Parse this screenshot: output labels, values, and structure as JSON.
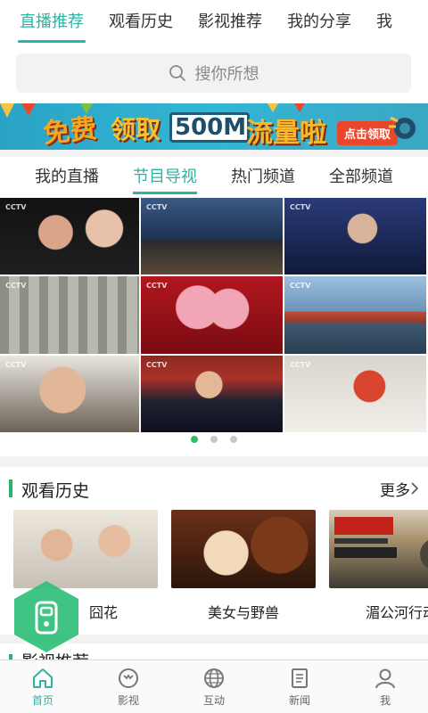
{
  "top_tabs": [
    {
      "label": "直播推荐",
      "active": true
    },
    {
      "label": "观看历史",
      "active": false
    },
    {
      "label": "影视推荐",
      "active": false
    },
    {
      "label": "我的分享",
      "active": false
    },
    {
      "label": "我",
      "active": false
    }
  ],
  "search": {
    "placeholder": "搜你所想"
  },
  "banner": {
    "text_free": "免费",
    "text_get": "领取",
    "text_amount": "500M",
    "text_flow": "流量啦",
    "cta": "点击领取"
  },
  "channel_tabs": [
    {
      "label": "我的直播",
      "active": false
    },
    {
      "label": "节目导视",
      "active": true
    },
    {
      "label": "热门频道",
      "active": false
    },
    {
      "label": "全部频道",
      "active": false
    }
  ],
  "video_grid": {
    "channel_logo": "CCTV",
    "items": [
      {
        "name": "video-1"
      },
      {
        "name": "video-2"
      },
      {
        "name": "video-3"
      },
      {
        "name": "video-4"
      },
      {
        "name": "video-5"
      },
      {
        "name": "video-6"
      },
      {
        "name": "video-7"
      },
      {
        "name": "video-8"
      },
      {
        "name": "video-9"
      }
    ],
    "page_indicator": {
      "count": 3,
      "active_index": 0
    }
  },
  "history": {
    "title": "观看历史",
    "more": "更多",
    "items": [
      {
        "title": "囧花"
      },
      {
        "title": "美女与野兽"
      },
      {
        "title": "湄公河行动"
      }
    ]
  },
  "next_section": {
    "title": "影视推荐"
  },
  "bottom_nav": [
    {
      "label": "首页",
      "icon": "home-icon",
      "active": true
    },
    {
      "label": "影视",
      "icon": "film-icon",
      "active": false
    },
    {
      "label": "互动",
      "icon": "globe-icon",
      "active": false
    },
    {
      "label": "新闻",
      "icon": "news-icon",
      "active": false
    },
    {
      "label": "我",
      "icon": "user-icon",
      "active": false
    }
  ],
  "colors": {
    "accent": "#2bb3a3",
    "section_bar": "#2bb36a",
    "indicator_active": "#32b96a"
  }
}
